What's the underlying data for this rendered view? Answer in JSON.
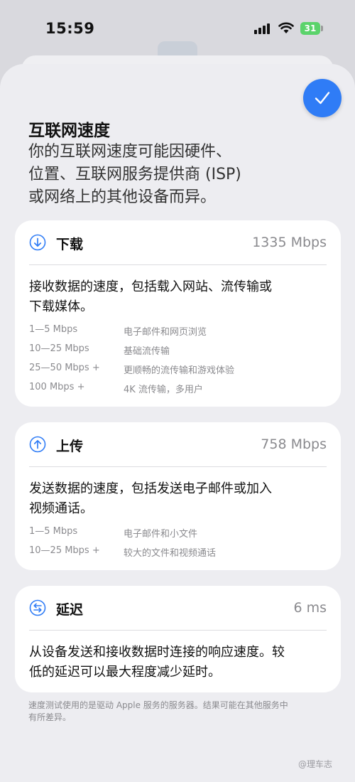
{
  "status_bar": {
    "time": "15:59",
    "battery": "31"
  },
  "header": {
    "title": "互联网速度",
    "description": "你的互联网速度可能因硬件、\n位置、互联网服务提供商 (ISP)\n或网络上的其他设备而异。"
  },
  "download": {
    "title": "下载",
    "value": "1335 Mbps",
    "description": "接收数据的速度，包括载入网站、流传输或\n下载媒体。",
    "rows": [
      {
        "speed": "1—5 Mbps",
        "use": "电子邮件和网页浏览"
      },
      {
        "speed": "10—25 Mbps",
        "use": "基础流传输"
      },
      {
        "speed": "25—50 Mbps +",
        "use": "更顺畅的流传输和游戏体验"
      },
      {
        "speed": "100 Mbps +",
        "use": "4K 流传输，多用户"
      }
    ]
  },
  "upload": {
    "title": "上传",
    "value": "758 Mbps",
    "description": "发送数据的速度，包括发送电子邮件或加入\n视频通话。",
    "rows": [
      {
        "speed": "1—5 Mbps",
        "use": "电子邮件和小文件"
      },
      {
        "speed": "10—25 Mbps +",
        "use": "较大的文件和视频通话"
      }
    ]
  },
  "latency": {
    "title": "延迟",
    "value": "6 ms",
    "description": "从设备发送和接收数据时连接的响应速度。较\n低的延迟可以最大程度减少延时。"
  },
  "footnote": "速度测试使用的是驱动 Apple 服务的服务器。结果可能在其他服务中\n有所差异。",
  "watermark": "@理车志",
  "colors": {
    "accent": "#2f7cf6",
    "card": "#ffffff",
    "sheet": "#ededf1",
    "secondary_text": "#8a8a8e"
  },
  "icons": {
    "done": "checkmark-icon",
    "download": "arrow-down-circle-icon",
    "upload": "arrow-up-circle-icon",
    "latency": "arrows-left-right-circle-icon"
  }
}
